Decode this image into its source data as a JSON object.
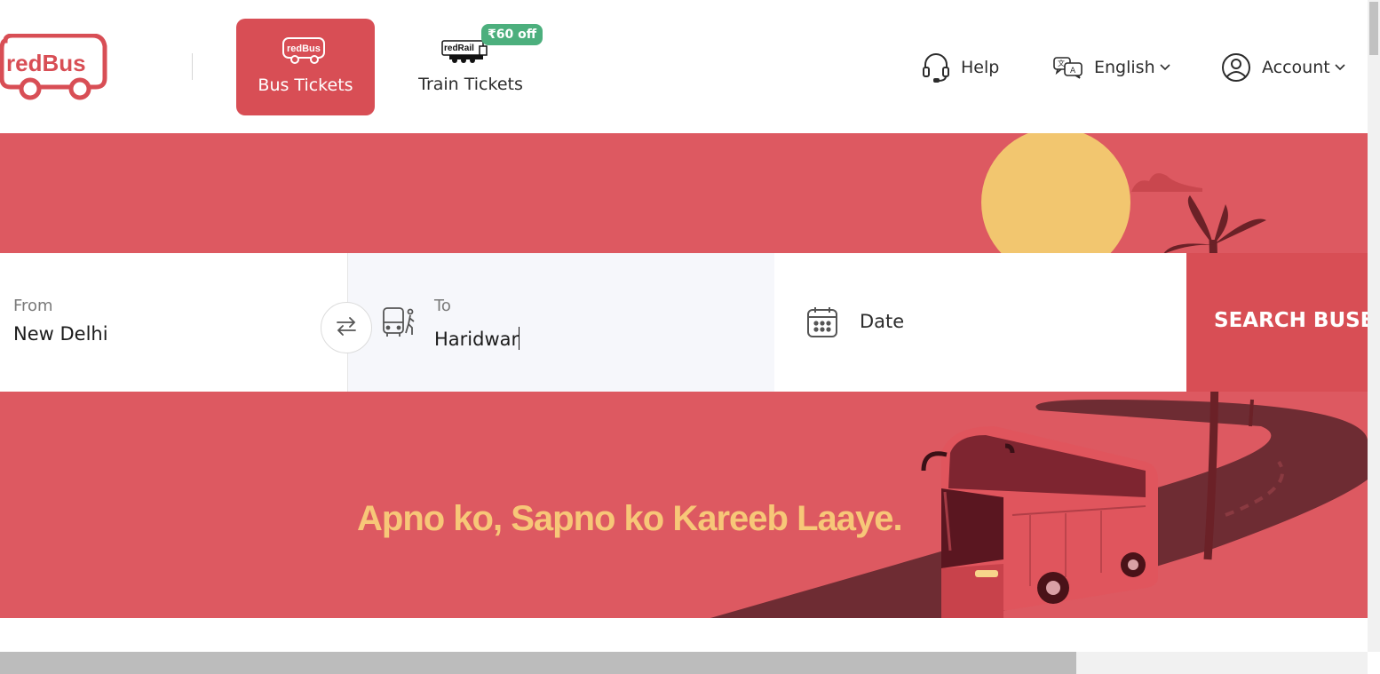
{
  "brand": {
    "logo_text": "redBus",
    "logo_color": "#d84e55"
  },
  "tabs": [
    {
      "label": "Bus Tickets",
      "icon": "redbus-bus-icon",
      "badge_text": "redBus",
      "active": true
    },
    {
      "label": "Train Tickets",
      "icon": "redrail-train-icon",
      "badge_text": "redRail",
      "offer": "₹60 off",
      "active": false
    }
  ],
  "nav": {
    "help": {
      "label": "Help",
      "icon": "headset-icon"
    },
    "language": {
      "label": "English",
      "icon": "translate-icon"
    },
    "account": {
      "label": "Account",
      "icon": "user-circle-icon"
    }
  },
  "search": {
    "from": {
      "label": "From",
      "value": "New Delhi"
    },
    "to": {
      "label": "To",
      "value": "Haridwar"
    },
    "date": {
      "label": "Date"
    },
    "button_label": "SEARCH BUSES"
  },
  "banner": {
    "tagline": "Apno ko, Sapno ko Kareeb Laaye.",
    "background_color": "#dd5961",
    "tagline_color": "#f7c778"
  }
}
